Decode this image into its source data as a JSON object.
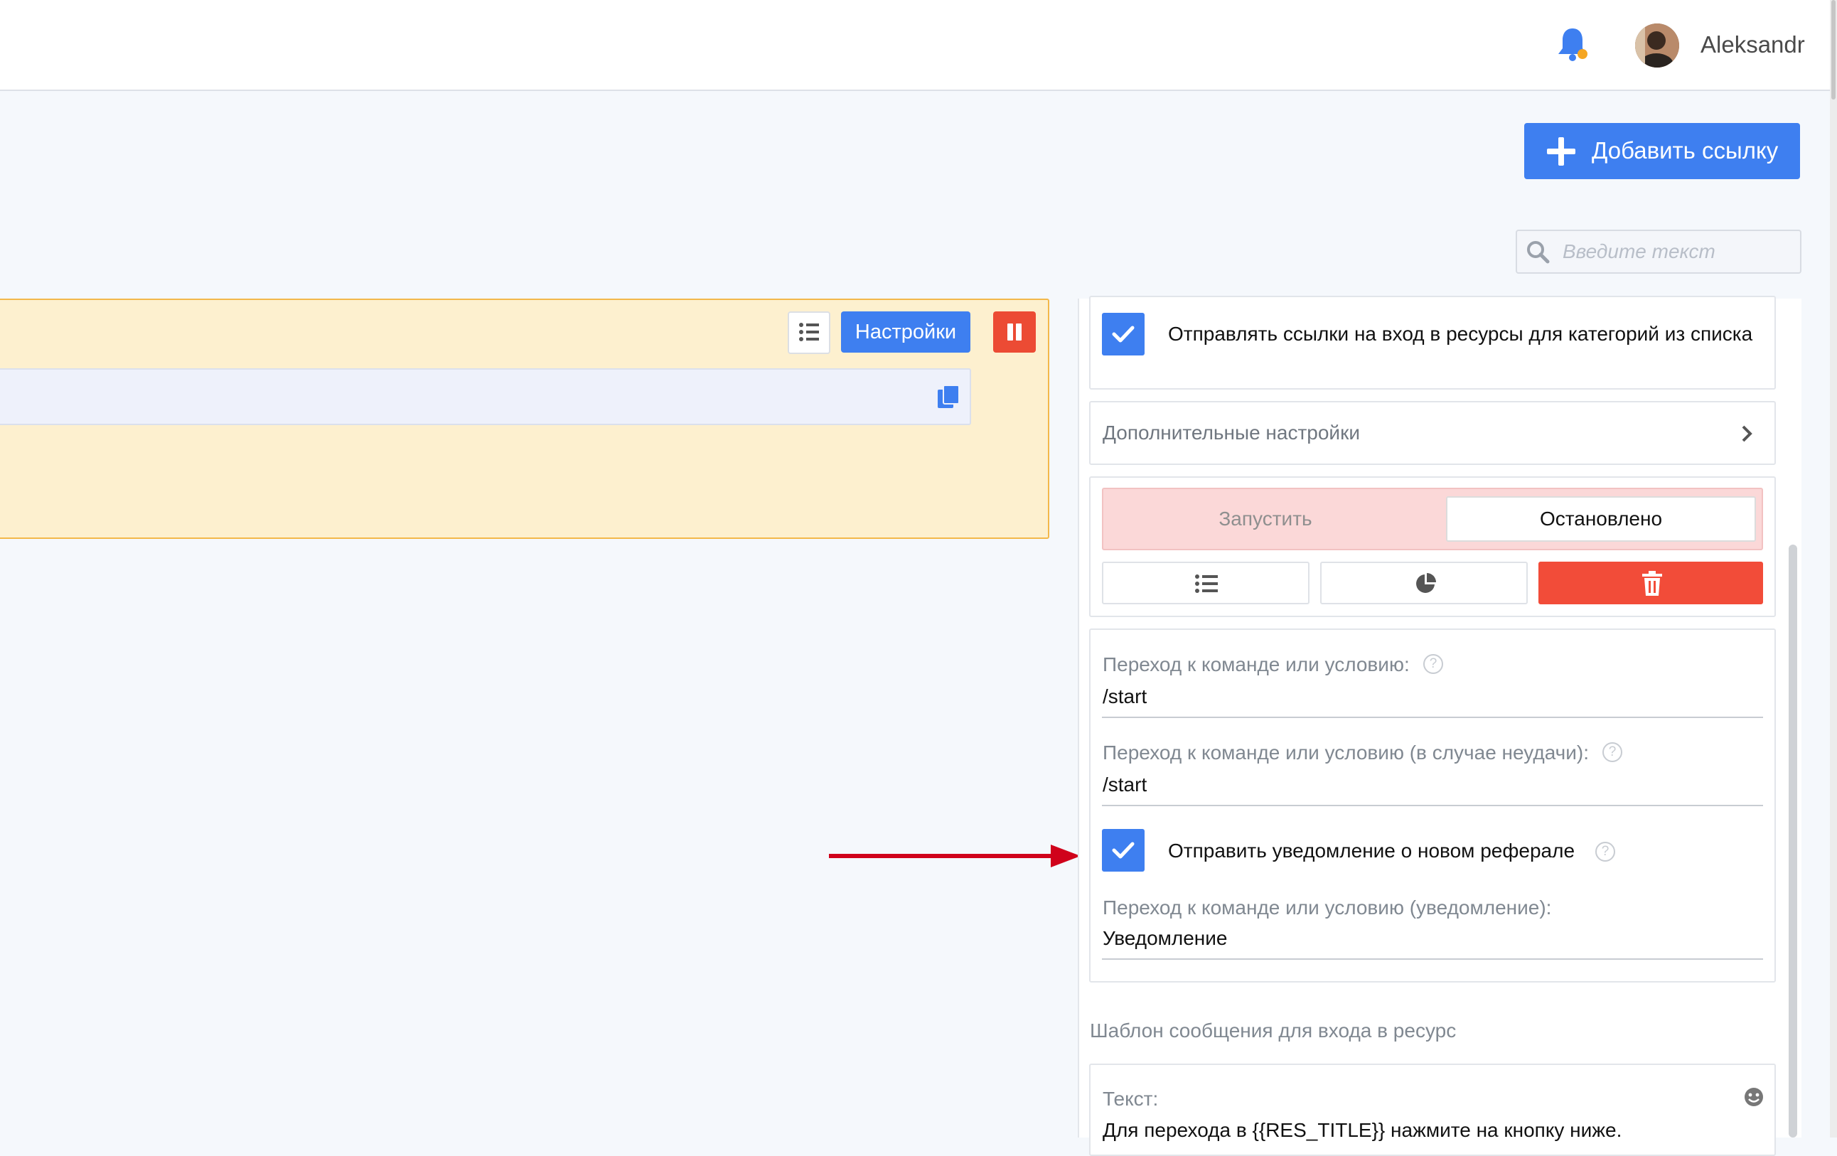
{
  "header": {
    "username": "Aleksandr"
  },
  "toolbar": {
    "add_link_label": "Добавить ссылку"
  },
  "search": {
    "placeholder": "Введите текст"
  },
  "link_card": {
    "settings_label": "Настройки"
  },
  "panel": {
    "send_links_label": "Отправлять ссылки на вход в ресурсы для категорий из списка",
    "extra_settings_label": "Дополнительные настройки",
    "start_label": "Запустить",
    "stopped_label": "Остановлено",
    "fields": {
      "command_label": "Переход к команде или условию:",
      "command_value": "/start",
      "fail_label": "Переход к команде или условию (в случае неудачи):",
      "fail_value": "/start",
      "notify_label": "Отправить уведомление о новом реферале",
      "notify_cmd_label": "Переход к команде или условию (уведомление):",
      "notify_cmd_value": "Уведомление"
    },
    "template_title": "Шаблон сообщения для входа в ресурс",
    "text_label": "Текст:",
    "text_value": "Для перехода в {{RES_TITLE}} нажмите на кнопку ниже."
  },
  "colors": {
    "accent": "#3e7ff0",
    "danger": "#f24c39",
    "card_bg": "#fdf0cf",
    "arrow": "#d0021b"
  },
  "icons": [
    "bell-icon",
    "plus-icon",
    "search-icon",
    "list-icon",
    "pause-icon",
    "copy-icon",
    "check-icon",
    "chevron-right-icon",
    "pie-chart-icon",
    "trash-icon",
    "help-icon",
    "emoji-icon"
  ]
}
